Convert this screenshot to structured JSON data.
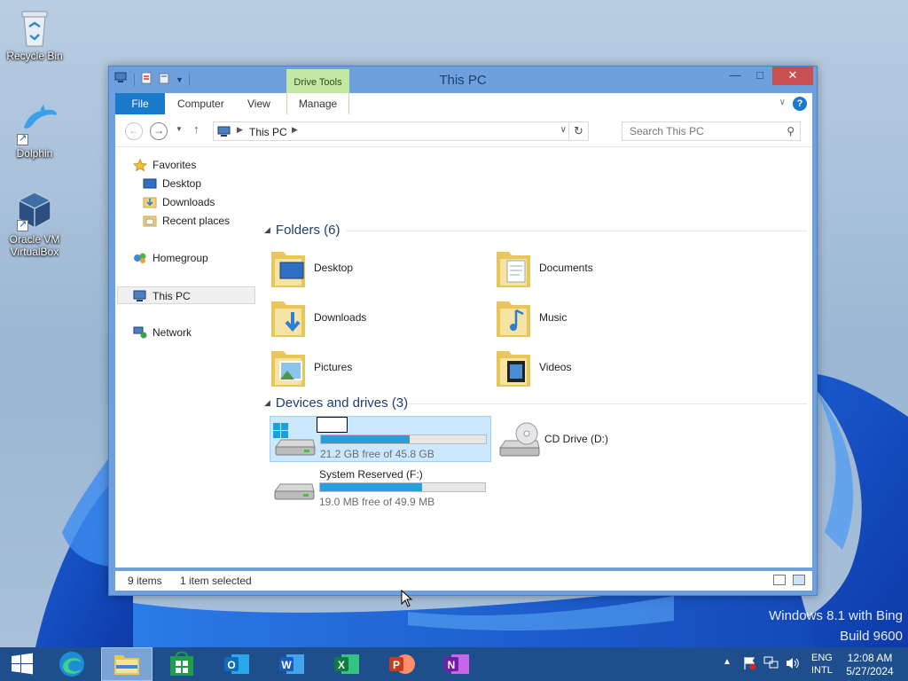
{
  "desktop": {
    "icons": [
      {
        "label": "Recycle Bin",
        "icon": "recycle-bin-icon"
      },
      {
        "label": "Dolphin",
        "icon": "dolphin-icon"
      },
      {
        "label_line1": "Oracle VM",
        "label_line2": "VirtualBox",
        "icon": "virtualbox-icon"
      }
    ],
    "watermark_line1": "Windows 8.1 with Bing",
    "watermark_line2": "Build 9600"
  },
  "window": {
    "title": "This PC",
    "context_tab": "Drive Tools",
    "ribbon_tabs": [
      "File",
      "Computer",
      "View",
      "Manage"
    ],
    "address_crumb": "This PC",
    "search_placeholder": "Search This PC",
    "nav_pane": {
      "favorites": "Favorites",
      "favorites_items": [
        "Desktop",
        "Downloads",
        "Recent places"
      ],
      "homegroup": "Homegroup",
      "this_pc": "This PC",
      "network": "Network"
    },
    "folders_header": "Folders (6)",
    "folders": [
      "Desktop",
      "Documents",
      "Downloads",
      "Music",
      "Pictures",
      "Videos"
    ],
    "devices_header": "Devices and drives (3)",
    "drives": [
      {
        "name": "",
        "free_text": "21.2 GB free of 45.8 GB",
        "used_fraction": 0.54,
        "selected": true,
        "renaming": true
      },
      {
        "name": "CD Drive (D:)",
        "type": "cd"
      },
      {
        "name": "System Reserved (F:)",
        "free_text": "19.0 MB free of 49.9 MB",
        "used_fraction": 0.62
      }
    ],
    "status_items": "9 items",
    "status_selected": "1 item selected"
  },
  "taskbar": {
    "apps": [
      "start-icon",
      "edge-icon",
      "file-explorer-icon",
      "store-icon",
      "outlook-icon",
      "word-icon",
      "excel-icon",
      "powerpoint-icon",
      "onenote-icon"
    ],
    "lang_line1": "ENG",
    "lang_line2": "INTL",
    "time": "12:08 AM",
    "date": "5/27/2024"
  },
  "colors": {
    "accent": "#1979ca",
    "titlebar": "#6fa0de",
    "context_tab": "#c3e8a4",
    "drive_bar": "#26a0da",
    "taskbar": "#1e4f8c",
    "close": "#c75050"
  }
}
